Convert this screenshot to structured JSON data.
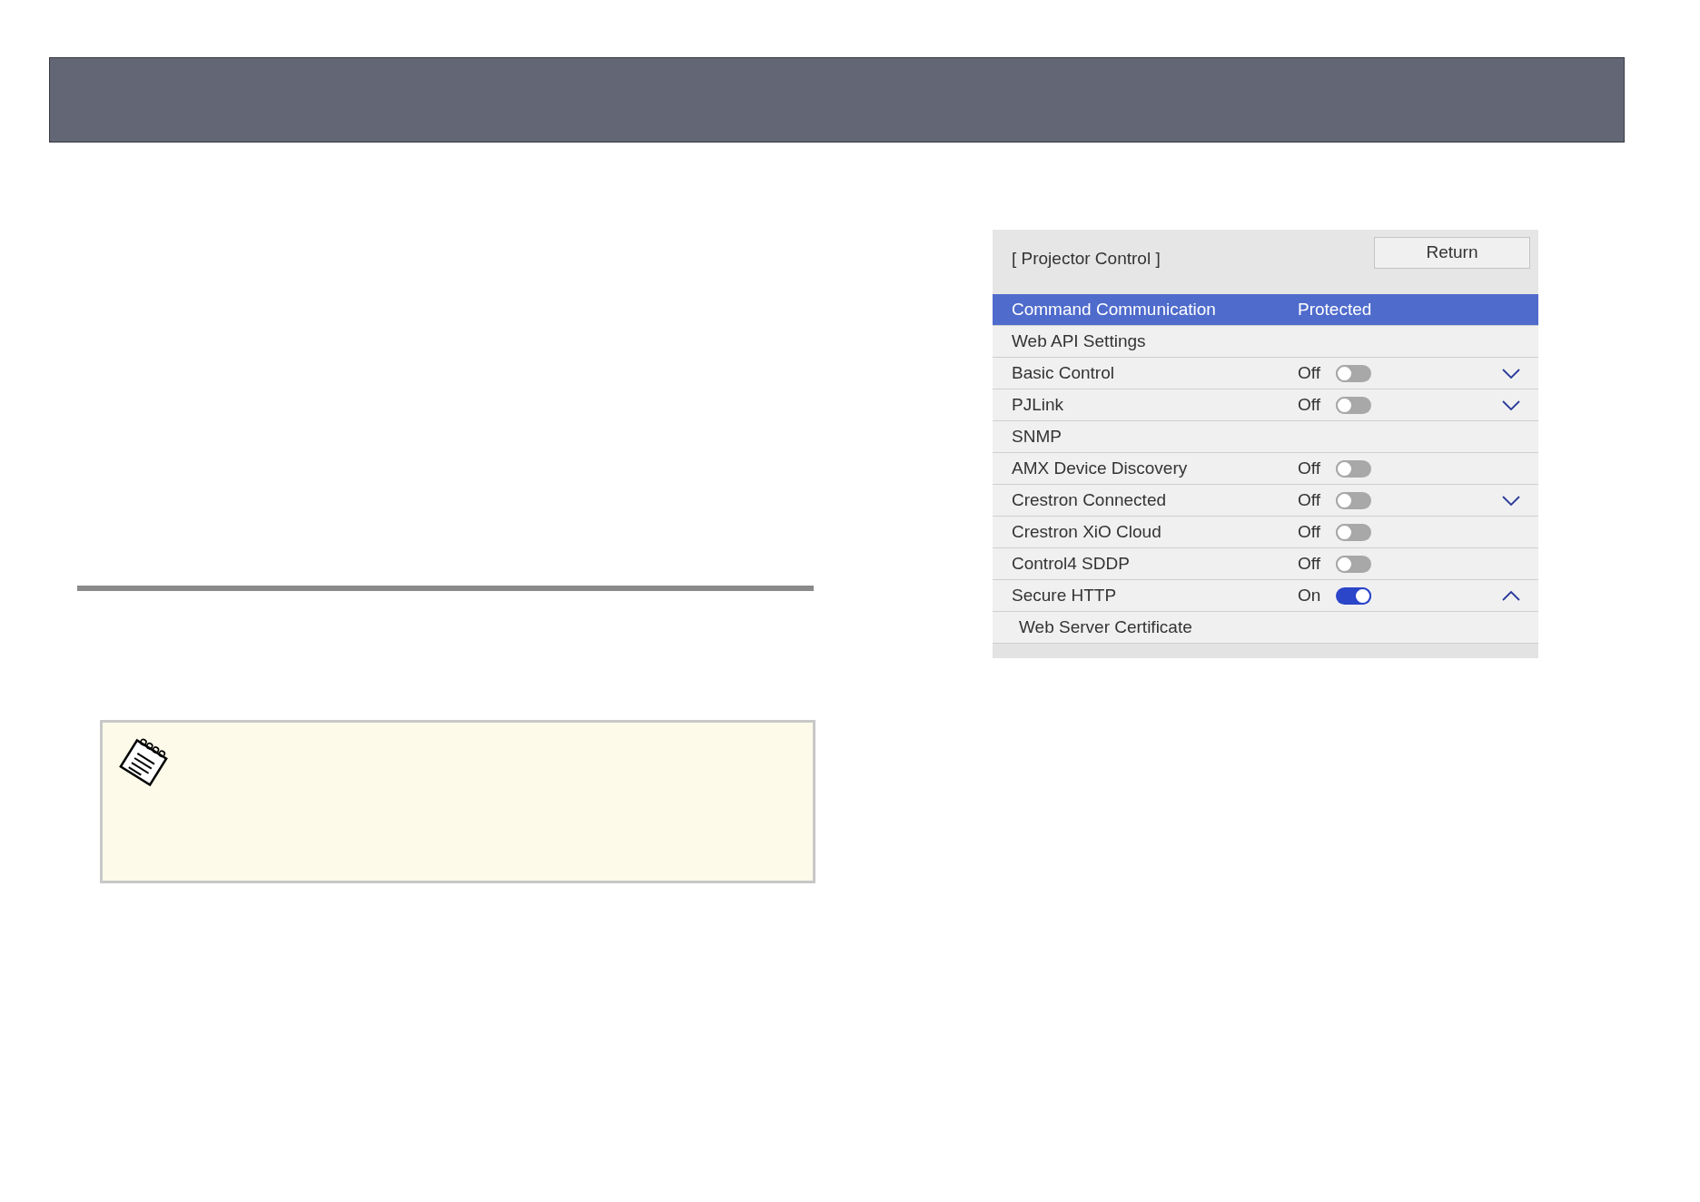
{
  "panel": {
    "title": "[ Projector Control ]",
    "return_button": "Return",
    "rows": [
      {
        "kind": "value",
        "label": "Command Communication",
        "value": "Protected",
        "selected": true
      },
      {
        "kind": "link",
        "label": "Web API Settings",
        "selected": false
      },
      {
        "kind": "toggle",
        "label": "Basic Control",
        "value": "Off",
        "on": false,
        "expanded": false,
        "selected": false
      },
      {
        "kind": "toggle",
        "label": "PJLink",
        "value": "Off",
        "on": false,
        "expanded": false,
        "selected": false
      },
      {
        "kind": "link",
        "label": "SNMP",
        "selected": false
      },
      {
        "kind": "toggle",
        "label": "AMX Device Discovery",
        "value": "Off",
        "on": false,
        "selected": false
      },
      {
        "kind": "toggle",
        "label": "Crestron Connected",
        "value": "Off",
        "on": false,
        "expanded": false,
        "selected": false
      },
      {
        "kind": "toggle",
        "label": "Crestron XiO Cloud",
        "value": "Off",
        "on": false,
        "selected": false
      },
      {
        "kind": "toggle",
        "label": "Control4 SDDP",
        "value": "Off",
        "on": false,
        "selected": false
      },
      {
        "kind": "toggle",
        "label": "Secure HTTP",
        "value": "On",
        "on": true,
        "expanded": true,
        "selected": false,
        "children": [
          {
            "kind": "link",
            "label": "Web Server Certificate",
            "selected": false
          }
        ]
      }
    ]
  }
}
